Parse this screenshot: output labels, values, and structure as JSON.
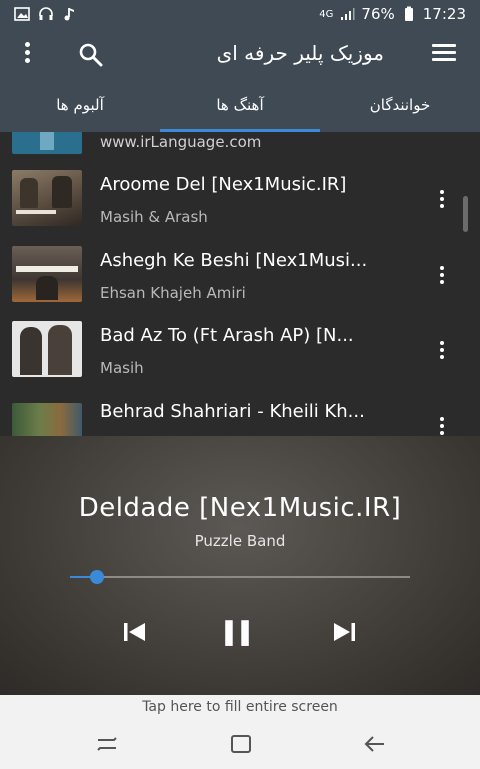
{
  "status_bar": {
    "network": "4G",
    "battery": "76%",
    "time": "17:23"
  },
  "header": {
    "title": "موزیک پلیر حرفه ای",
    "icons": [
      "overflow-icon",
      "search-icon",
      "menu-icon"
    ]
  },
  "tabs": [
    {
      "label": "آلبوم ها",
      "active": false
    },
    {
      "label": "آهنگ ها",
      "active": true
    },
    {
      "label": "خوانندگان",
      "active": false
    }
  ],
  "song_list": [
    {
      "title": "",
      "subtitle": "www.irLanguage.com"
    },
    {
      "title": "Aroome Del [Nex1Music.IR]",
      "subtitle": "Masih & Arash"
    },
    {
      "title": "Ashegh Ke Beshi [Nex1Musi...",
      "subtitle": "Ehsan Khajeh Amiri"
    },
    {
      "title": "Bad Az To (Ft Arash AP) [N...",
      "subtitle": "Masih"
    },
    {
      "title": "Behrad Shahriari - Kheili Kh...",
      "subtitle": ""
    }
  ],
  "player": {
    "title": "Deldade [Nex1Music.IR]",
    "artist": "Puzzle Band",
    "progress": 0.08,
    "controls": [
      "previous-icon",
      "pause-icon",
      "next-icon"
    ],
    "accent": "#3b8ad9"
  },
  "fill_banner": "Tap here to fill entire screen",
  "colors": {
    "header_bg": "#404a54",
    "list_bg": "#2b2b2b",
    "accent": "#3b8ad9"
  }
}
